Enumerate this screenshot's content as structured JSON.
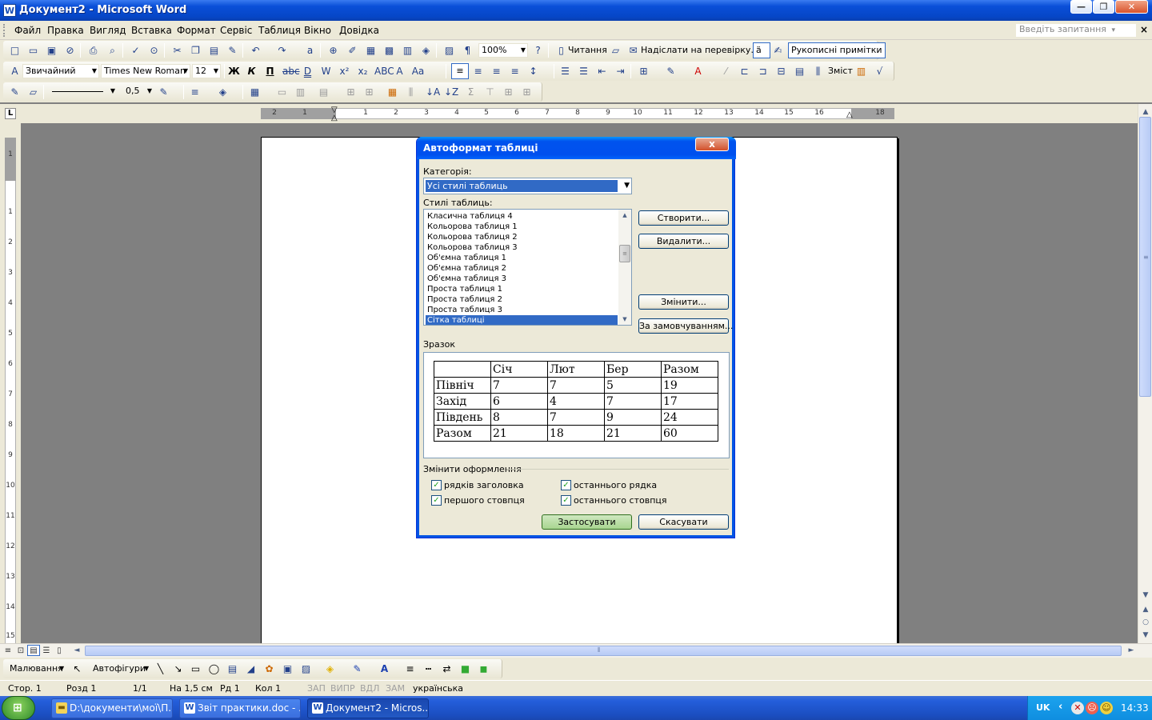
{
  "window": {
    "title": "Документ2 - Microsoft Word",
    "app_icon": "W",
    "buttons": {
      "minimize": "—",
      "restore": "❐",
      "close": "✕"
    }
  },
  "menu": {
    "items": [
      "Файл",
      "Правка",
      "Вигляд",
      "Вставка",
      "Формат",
      "Сервіс",
      "Таблиця",
      "Вікно",
      "Довідка"
    ],
    "help_placeholder": "Введіть запитання",
    "close_glyph": "×"
  },
  "standard_toolbar": {
    "zoom": "100%",
    "reading_label": "Читання",
    "send_review_label": "Надіслати на перевірку…",
    "ink_annotations_label": "Рукописні примітки"
  },
  "formatting_toolbar": {
    "style": "Звичайний",
    "font": "Times New Roman",
    "size": "12",
    "toc_label": "Зміст"
  },
  "tables_toolbar": {
    "line_weight": "0,5"
  },
  "ruler": {
    "tab_selector": "L",
    "h_numbers": [
      "2",
      "1",
      "1",
      "2",
      "3",
      "4",
      "5",
      "6",
      "7",
      "8",
      "9",
      "10",
      "11",
      "12",
      "13",
      "14",
      "15",
      "16",
      "18"
    ],
    "v_numbers": [
      "1",
      "1",
      "2",
      "3",
      "4",
      "5",
      "6",
      "7",
      "8",
      "9",
      "10",
      "11",
      "12",
      "13",
      "14",
      "15"
    ]
  },
  "dialog": {
    "title": "Автоформат таблиці",
    "close_glyph": "x",
    "category_label": "Категорія:",
    "category_value": "Усі стилі таблиць",
    "styles_label": "Стилі таблиць:",
    "styles": [
      "Класична таблиця 4",
      "Кольорова таблиця 1",
      "Кольорова таблиця 2",
      "Кольорова таблиця 3",
      "Об'ємна таблиця 1",
      "Об'ємна таблиця 2",
      "Об'ємна таблиця 3",
      "Проста таблиця 1",
      "Проста таблиця 2",
      "Проста таблиця 3",
      "Сітка таблиці"
    ],
    "selected_style": "Сітка таблиці",
    "buttons": {
      "create": "Створити...",
      "delete": "Видалити...",
      "modify": "Змінити...",
      "default": "За замовчуванням...",
      "apply": "Застосувати",
      "cancel": "Скасувати"
    },
    "preview_label": "Зразок",
    "preview_table": [
      [
        "",
        "Січ",
        "Лют",
        "Бер",
        "Разом"
      ],
      [
        "Північ",
        "7",
        "7",
        "5",
        "19"
      ],
      [
        "Захід",
        "6",
        "4",
        "7",
        "17"
      ],
      [
        "Південь",
        "8",
        "7",
        "9",
        "24"
      ],
      [
        "Разом",
        "21",
        "18",
        "21",
        "60"
      ]
    ],
    "apply_special_label": "Змінити оформлення",
    "checkboxes": {
      "header_rows": {
        "label": "рядків заголовка",
        "checked": true
      },
      "last_row": {
        "label": "останнього рядка",
        "checked": true
      },
      "first_column": {
        "label": "першого стовпця",
        "checked": true
      },
      "last_column": {
        "label": "останнього стовпця",
        "checked": true
      }
    }
  },
  "drawing_toolbar": {
    "draw_label": "Малювання",
    "autoshapes_label": "Автофігури"
  },
  "status": {
    "page": "Стор. 1",
    "section": "Розд 1",
    "pages": "1/1",
    "at": "На 1,5 см",
    "line": "Рд 1",
    "col": "Кол 1",
    "rec": "ЗАП",
    "trk": "ВИПР",
    "ext": "ВДЛ",
    "ovr": "ЗАМ",
    "language": "українська"
  },
  "taskbar": {
    "tasks": [
      "D:\\документи\\мої\\П...",
      "Звіт практики.doc - ...",
      "Документ2 - Micros..."
    ],
    "lang": "UK",
    "clock": "14:33"
  },
  "colors": {
    "xp_blue": "#0a4fd8",
    "selection": "#316ac5",
    "toolbar_bg": "#ece9d8",
    "apply_button": "#a8d590"
  }
}
